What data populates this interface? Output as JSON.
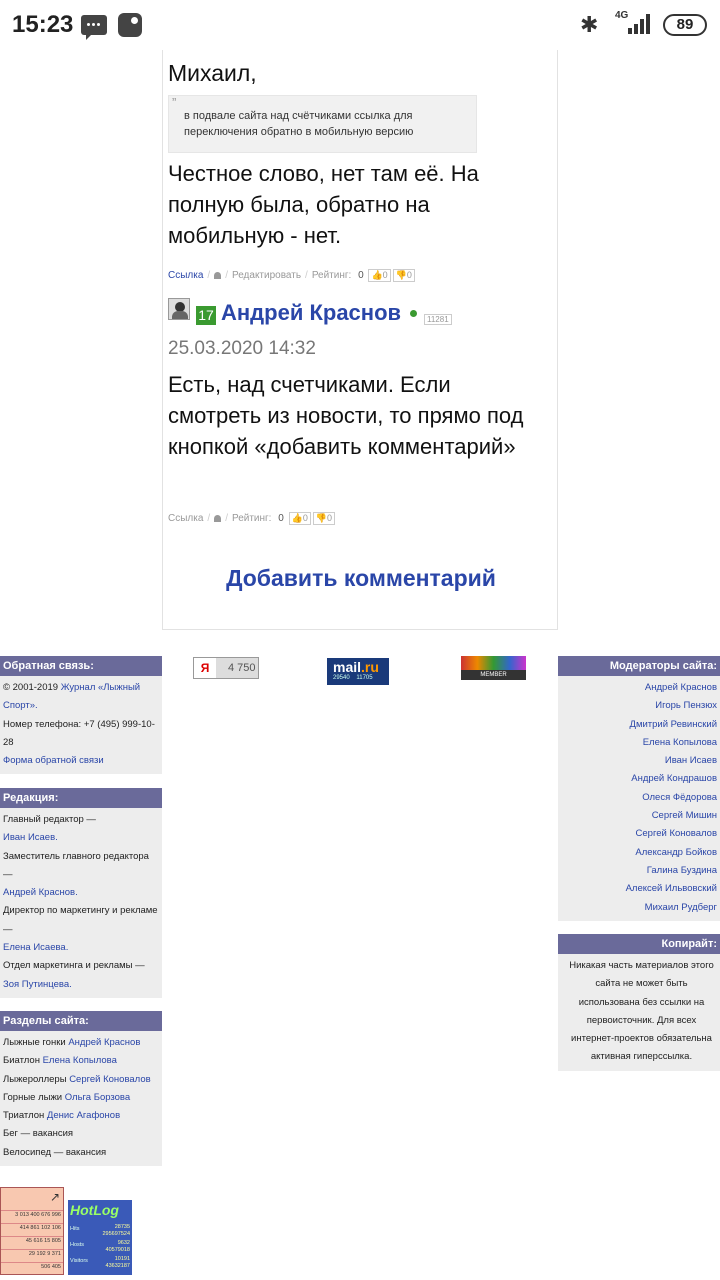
{
  "status": {
    "time": "15:23",
    "network": "4G",
    "battery": "89"
  },
  "comment1": {
    "name": "Михаил,",
    "quote": "в подвале сайта над счётчиками ссылка для переключения обратно в мобильную версию",
    "text": "Честное слово, нет там её. На полную была, обратно на мобильную - нет.",
    "link": "Ссылка",
    "edit": "Редактировать",
    "rating_label": "Рейтинг:",
    "rating": "0",
    "up": "0",
    "down": "0"
  },
  "comment2": {
    "level": "17",
    "author": "Андрей Краснов",
    "uid": "11281",
    "date": "25.03.2020 14:32",
    "text": "Есть, над счетчиками. Если смотреть из новости, то прямо под кнопкой «добавить комментарий»",
    "link": "Ссылка",
    "rating_label": "Рейтинг:",
    "rating": "0",
    "up": "0",
    "down": "0"
  },
  "add_comment": "Добавить комментарий",
  "feedback": {
    "title": "Обратная связь:",
    "copyright": "© 2001-2019",
    "journal": "Журнал «Лыжный Спорт».",
    "phone": "Номер телефона: +7 (495) 999-10-28",
    "form": "Форма обратной связи"
  },
  "editorial": {
    "title": "Редакция:",
    "chief_label": "Главный редактор —",
    "chief": "Иван Исаев.",
    "deputy_label": "Заместитель главного редактора —",
    "deputy": "Андрей Краснов.",
    "marketing_label": "Директор по маркетингу и рекламе —",
    "marketing": "Елена Исаева.",
    "dept_label": "Отдел маркетинга и рекламы —",
    "dept": "Зоя Путинцева."
  },
  "sections": {
    "title": "Разделы сайта:",
    "items": [
      {
        "label": "Лыжные гонки",
        "person": "Андрей Краснов"
      },
      {
        "label": "Биатлон",
        "person": "Елена Копылова"
      },
      {
        "label": "Лыжероллеры",
        "person": "Сергей Коновалов"
      },
      {
        "label": "Горные лыжи",
        "person": "Ольга Борзова"
      },
      {
        "label": "Триатлон",
        "person": "Денис Агафонов"
      },
      {
        "label": "Бег — вакансия",
        "person": ""
      },
      {
        "label": "Велосипед — вакансия",
        "person": ""
      }
    ]
  },
  "moderators": {
    "title": "Модераторы сайта:",
    "items": [
      "Андрей Краснов",
      "Игорь Пензюх",
      "Дмитрий Ревинский",
      "Елена Копылова",
      "Иван Исаев",
      "Андрей Кондрашов",
      "Олеся Фёдорова",
      "Сергей Мишин",
      "Сергей Коновалов",
      "Александр Бойков",
      "Галина Буздина",
      "Алексей Ильвовский",
      "Михаил Рудберг"
    ]
  },
  "copyright": {
    "title": "Копирайт:",
    "text": "Никакая часть материалов этого сайта не может быть использована без ссылки на первоисточник. Для всех интернет-проектов обязательна активная гиперссылка."
  },
  "badges": {
    "yandex": {
      "logo": "Я",
      "value": "4 750"
    },
    "mail": {
      "logo1": "mail",
      "logo2": ".ru",
      "n1": "29540",
      "n2": "11705"
    },
    "member": "MEMBER",
    "counter": [
      "3 013 400 676 996",
      "414 861 102 106",
      "45 616 15 805",
      "29 192 9 371",
      "506 405"
    ],
    "hotlog": {
      "logo": "HotLog",
      "hits_label": "Hits",
      "hits": "28735",
      "hits_total": "295697524",
      "hosts_label": "Hosts",
      "hosts": "9632",
      "hosts_total": "40579018",
      "visitors_label": "Visitors",
      "visitors": "10191",
      "visitors_total": "43632187"
    }
  }
}
